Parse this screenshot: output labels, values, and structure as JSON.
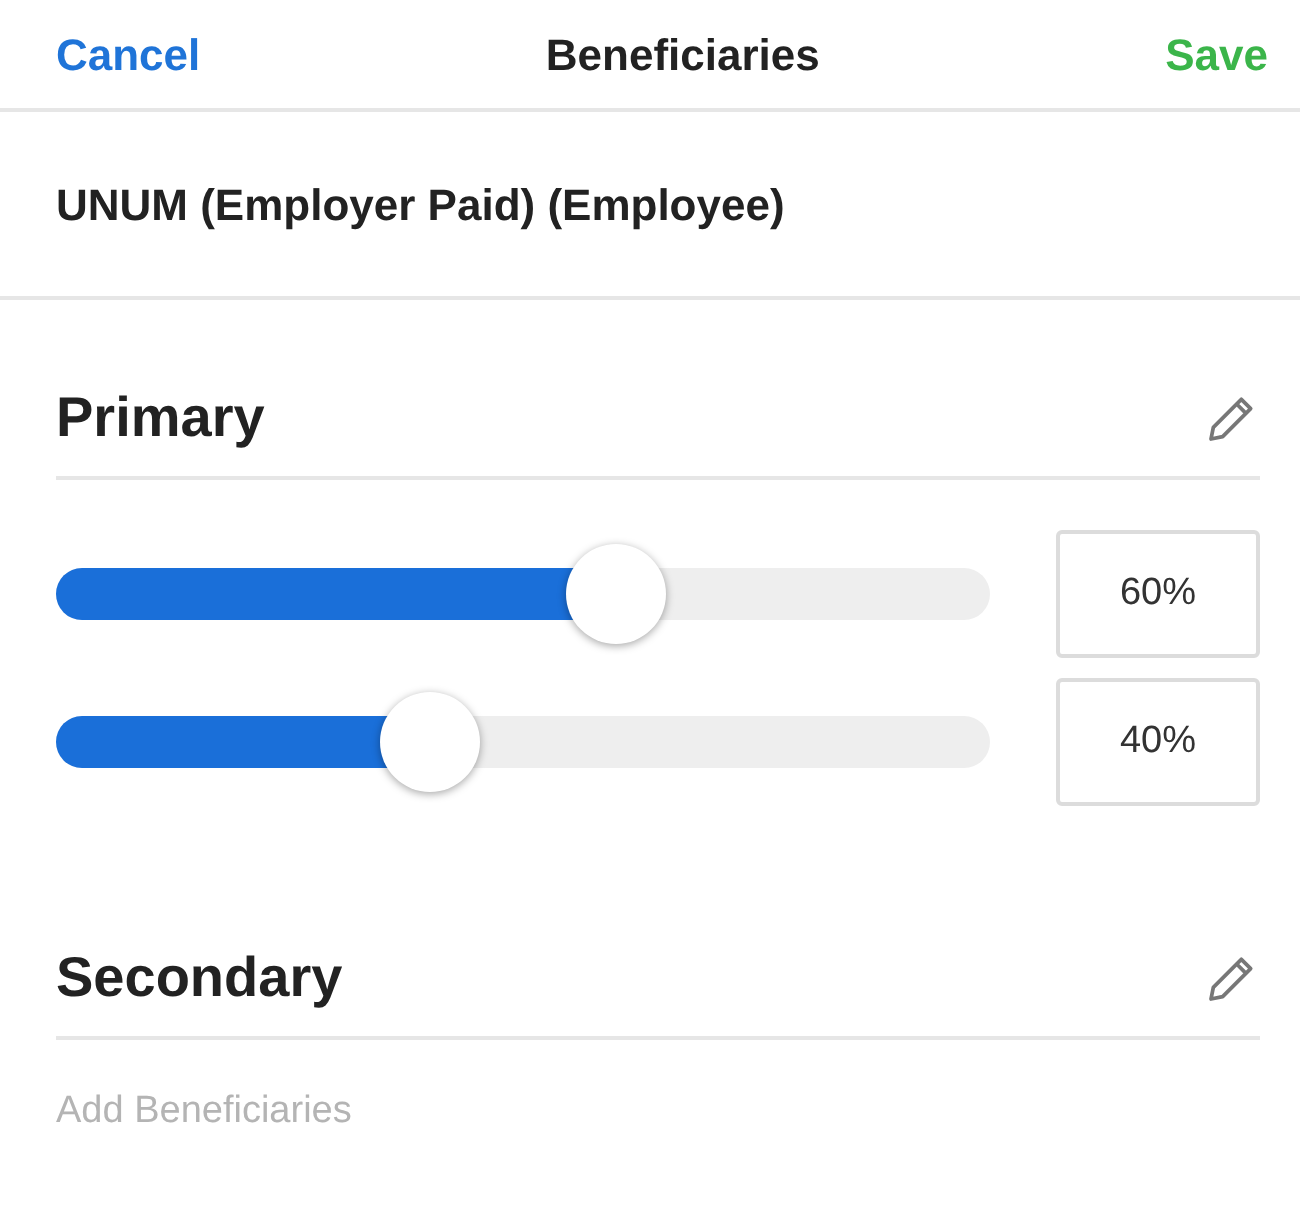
{
  "header": {
    "cancel": "Cancel",
    "title": "Beneficiaries",
    "save": "Save"
  },
  "plan": "UNUM (Employer Paid) (Employee)",
  "sections": [
    {
      "title": "Primary",
      "sliders": [
        {
          "level": 0.6,
          "value": "60%"
        },
        {
          "level": 0.4,
          "value": "40%"
        }
      ]
    },
    {
      "title": "Secondary",
      "placeholder": "Add Beneficiaries"
    }
  ]
}
